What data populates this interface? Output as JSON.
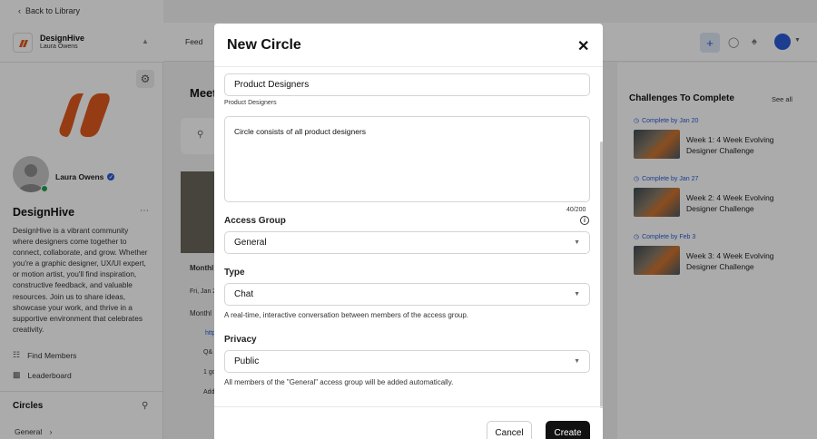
{
  "nav": {
    "back_label": "Back to Library",
    "feed_label": "Feed"
  },
  "community": {
    "name": "DesignHive",
    "user": "Laura Owens"
  },
  "sidebar": {
    "username": "Laura Owens",
    "title": "DesignHive",
    "description": "DesignHive is a vibrant community where designers come together to connect, collaborate, and grow. Whether you're a graphic designer, UX/UI expert, or motion artist, you'll find inspiration, constructive feedback, and valuable resources. Join us to share ideas, showcase your work, and thrive in a supportive environment that celebrates creativity.",
    "links": [
      {
        "label": "Find Members",
        "icon": "people-icon"
      },
      {
        "label": "Leaderboard",
        "icon": "bar-chart-icon"
      }
    ],
    "circles_heading": "Circles",
    "circles": [
      {
        "label": "General"
      }
    ]
  },
  "main": {
    "title_fragment": "Meet",
    "item_title_fragment": "Monthl",
    "date_fragment": "Fri, Jan 2",
    "text_fragment": "Monthl",
    "link_fragment": "http",
    "qa_fragment": "Q&",
    "going_fragment": "1 go",
    "add_fragment": "Add"
  },
  "right_panel": {
    "title": "Challenges To Complete",
    "see_all": "See all",
    "challenges": [
      {
        "due": "Complete by Jan 20",
        "title": "Week 1: 4 Week Evolving Designer Challenge"
      },
      {
        "due": "Complete by Jan 27",
        "title": "Week 2: 4 Week Evolving Designer Challenge"
      },
      {
        "due": "Complete by Feb 3",
        "title": "Week 3: 4 Week Evolving Designer Challenge"
      }
    ]
  },
  "modal": {
    "title": "New Circle",
    "name_value": "Product Designers",
    "name_slug": "Product Designers",
    "description_value": "Circle consists of all product designers",
    "char_counter": "40/200",
    "access_group_label": "Access Group",
    "access_group_value": "General",
    "type_label": "Type",
    "type_value": "Chat",
    "type_helper": "A real-time, interactive conversation between members of the access group.",
    "privacy_label": "Privacy",
    "privacy_value": "Public",
    "privacy_helper": "All members of the \"General\" access group will be added automatically.",
    "cancel_label": "Cancel",
    "create_label": "Create"
  },
  "colors": {
    "accent": "#2a5bd7",
    "brand_orange": "#e05a1e",
    "primary_button": "#111111",
    "online": "#22a34a"
  }
}
